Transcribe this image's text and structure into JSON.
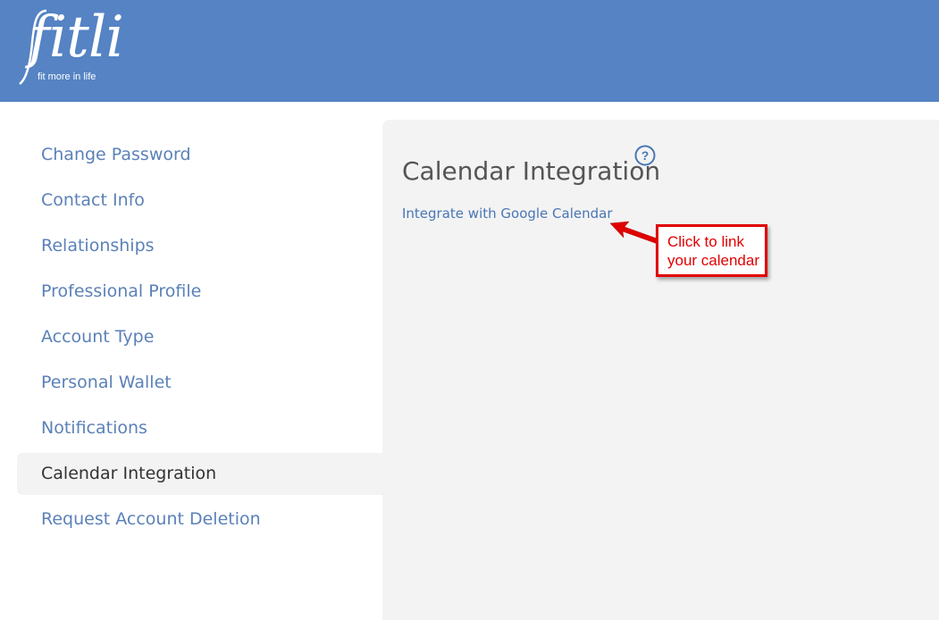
{
  "header": {
    "logo_text": "fitli",
    "logo_tagline": "fit more in life",
    "background_color": "#5583c4"
  },
  "sidebar": {
    "items": [
      {
        "label": "Change Password"
      },
      {
        "label": "Contact Info"
      },
      {
        "label": "Relationships"
      },
      {
        "label": "Professional Profile"
      },
      {
        "label": "Account Type"
      },
      {
        "label": "Personal Wallet"
      },
      {
        "label": "Notifications"
      },
      {
        "label": "Calendar Integration",
        "active": true
      },
      {
        "label": "Request Account Deletion"
      }
    ]
  },
  "main": {
    "title": "Calendar Integration",
    "help_icon": "question-circle-icon",
    "google_link": "Integrate with Google Calendar"
  },
  "annotation": {
    "line1": "Click to link",
    "line2": "your calendar",
    "color": "#e00000"
  }
}
